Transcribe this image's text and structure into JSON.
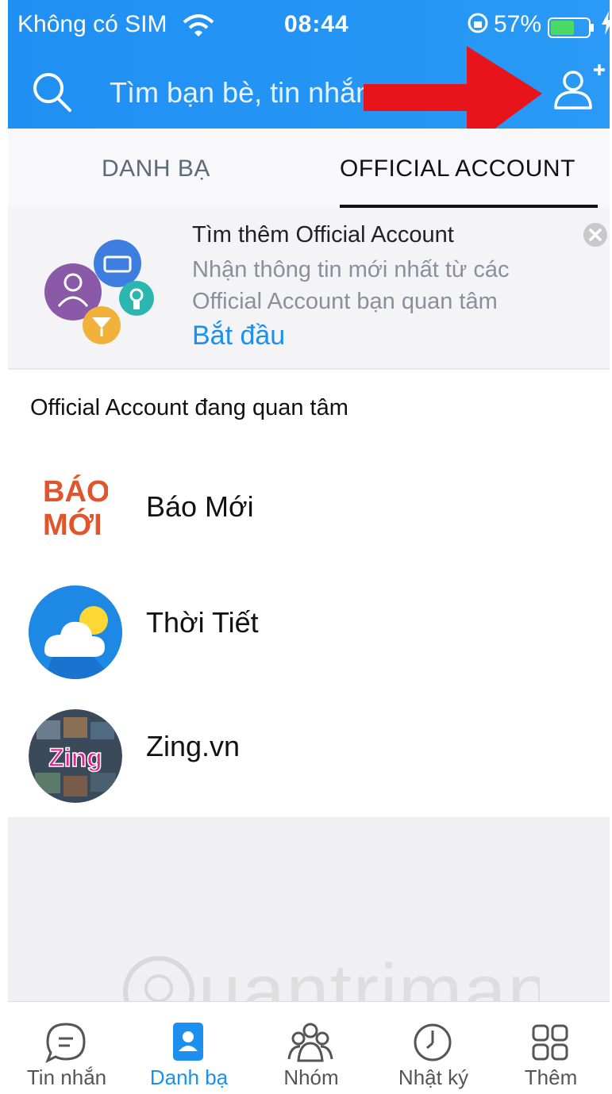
{
  "status_bar": {
    "carrier": "Không có SIM",
    "time": "08:44",
    "battery_percent": "57%"
  },
  "search": {
    "placeholder": "Tìm bạn bè, tin nhắn"
  },
  "tabs": [
    {
      "label": "DANH BẠ",
      "active": false
    },
    {
      "label": "OFFICIAL ACCOUNT",
      "active": true
    }
  ],
  "promo": {
    "title": "Tìm thêm Official Account",
    "description": "Nhận thông tin mới nhất từ các Official Account bạn quan tâm",
    "cta": "Bắt đầu"
  },
  "section": {
    "title": "Official Account đang quan tâm"
  },
  "accounts": [
    {
      "name": "Báo Mới",
      "logo_text_top": "BÁO",
      "logo_text_bottom": "MỚI"
    },
    {
      "name": "Thời Tiết"
    },
    {
      "name": "Zing.vn",
      "logo_text": "Zing"
    }
  ],
  "bottom_nav": [
    {
      "label": "Tin nhắn",
      "icon": "chat-icon",
      "active": false
    },
    {
      "label": "Danh bạ",
      "icon": "contacts-icon",
      "active": true
    },
    {
      "label": "Nhóm",
      "icon": "group-icon",
      "active": false
    },
    {
      "label": "Nhật ký",
      "icon": "clock-icon",
      "active": false
    },
    {
      "label": "Thêm",
      "icon": "grid-icon",
      "active": false
    }
  ],
  "watermark": "Quantrimang",
  "colors": {
    "header_blue": "#2196f3",
    "accent_blue": "#1c8fef",
    "arrow_red": "#e8141b"
  }
}
